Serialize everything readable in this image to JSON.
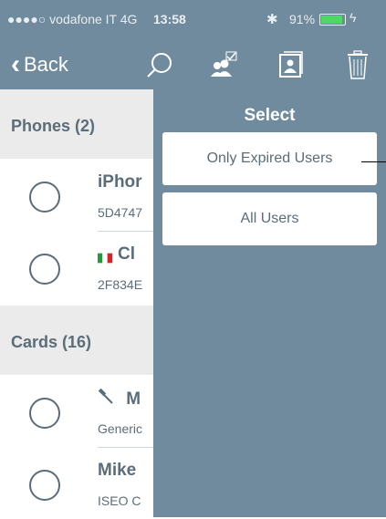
{
  "status_bar": {
    "carrier": "●●●●○ vodafone IT",
    "network": "4G",
    "time": "13:58",
    "battery_percent": "91%",
    "battery_level": 0.91,
    "bluetooth_icon": "bluetooth-icon",
    "charging_icon": "bolt-icon"
  },
  "nav": {
    "back_label": "Back",
    "icons": [
      "search-icon",
      "users-check-icon",
      "contact-card-icon",
      "trash-icon"
    ]
  },
  "sections": {
    "phones": {
      "header": "Phones (2)"
    },
    "cards": {
      "header": "Cards (16)"
    }
  },
  "rows": [
    {
      "title": "iPhor",
      "subtitle": "5D4747"
    },
    {
      "title": "Cl",
      "subtitle": "2F834E",
      "flag": "italy-flag"
    },
    {
      "title": "M",
      "subtitle": "Generic",
      "icon": "hammer-icon"
    },
    {
      "title": "Mike",
      "subtitle": "ISEO C"
    }
  ],
  "select_panel": {
    "title": "Select",
    "options": [
      "Only Expired Users",
      "All Users"
    ]
  },
  "colors": {
    "bar_blue": "#6f8b9d",
    "text_slate": "#5b6d79",
    "section_bg": "#ebebeb",
    "battery_green": "#4cd964"
  }
}
